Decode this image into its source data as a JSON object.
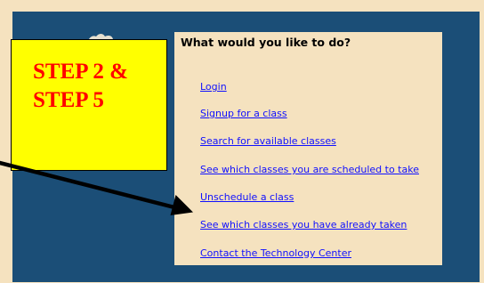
{
  "menu": {
    "heading": "What would you like to do?",
    "items": [
      {
        "label": "Login"
      },
      {
        "label": "Signup for a class"
      },
      {
        "label": "Search for available classes"
      },
      {
        "label": "See which classes you are scheduled to take"
      },
      {
        "label": "Unschedule a class"
      },
      {
        "label": "See which classes you have already taken"
      },
      {
        "label": "Contact the Technology Center"
      }
    ]
  },
  "callout": {
    "text": "STEP 2 & STEP 5",
    "background_color": "#ffff00",
    "text_color": "#ff0000"
  },
  "colors": {
    "page_background": "#f5e2bf",
    "panel_background": "#1b4e77",
    "link_color": "#1010ff",
    "arrow_color": "#000000"
  },
  "icons": {
    "arrow": "arrow-icon",
    "logo": "logo-icon"
  }
}
